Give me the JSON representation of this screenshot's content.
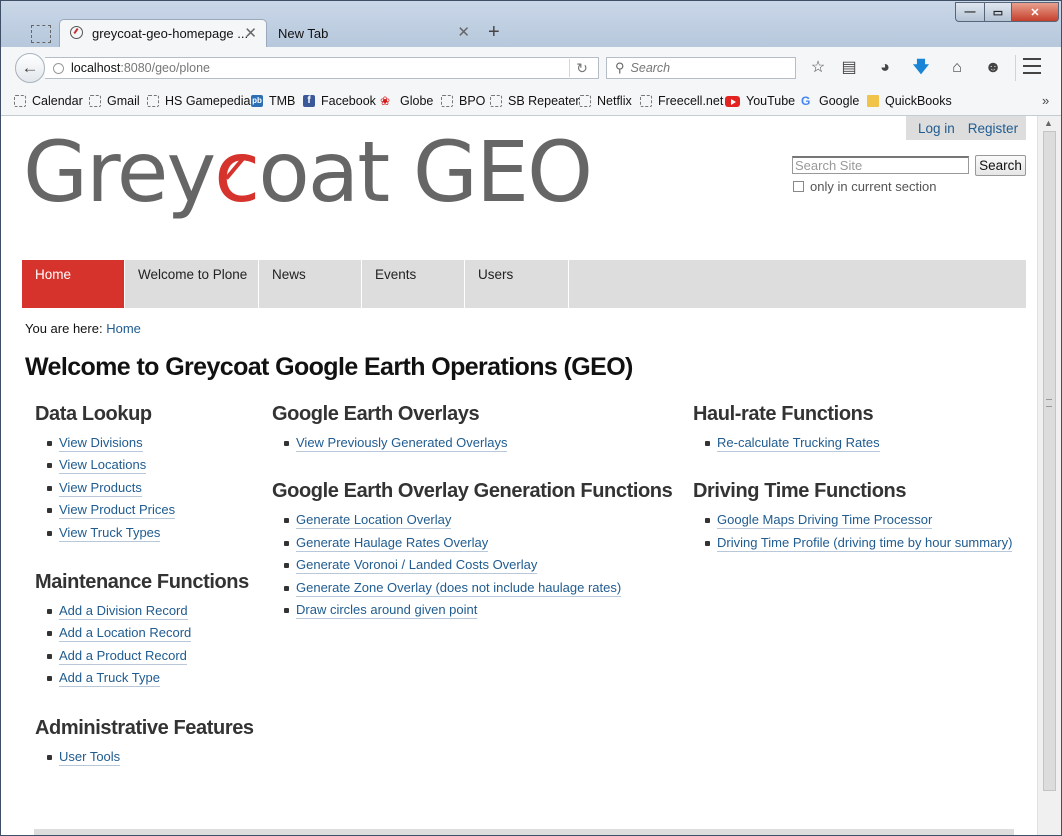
{
  "browser": {
    "tabs": [
      {
        "title": "greycoat-geo-homepage ...",
        "active": true
      },
      {
        "title": "New Tab",
        "active": false
      }
    ],
    "url_host": "localhost",
    "url_path": ":8080/geo/plone",
    "search_placeholder": "Search",
    "window_controls": {
      "minimize": "—",
      "maximize": "▭",
      "close": "✕"
    },
    "bookmarks": [
      {
        "label": "Calendar",
        "icon": "page"
      },
      {
        "label": "Gmail",
        "icon": "page"
      },
      {
        "label": "HS Gamepedia",
        "icon": "page"
      },
      {
        "label": "TMB",
        "icon": "pb"
      },
      {
        "label": "Facebook",
        "icon": "fb"
      },
      {
        "label": "Globe",
        "icon": "leaf"
      },
      {
        "label": "BPO",
        "icon": "page"
      },
      {
        "label": "SB Repeater",
        "icon": "page"
      },
      {
        "label": "Netflix",
        "icon": "page"
      },
      {
        "label": "Freecell.net",
        "icon": "page"
      },
      {
        "label": "YouTube",
        "icon": "yt"
      },
      {
        "label": "Google",
        "icon": "g"
      },
      {
        "label": "QuickBooks",
        "icon": "folder"
      }
    ]
  },
  "site": {
    "logo_left": "Grey",
    "logo_red": "c",
    "logo_right": "oat GEO",
    "login": "Log in",
    "register": "Register",
    "search_placeholder": "Search Site",
    "search_button": "Search",
    "section_only": "only in current section",
    "nav": [
      "Home",
      "Welcome to Plone",
      "News",
      "Events",
      "Users"
    ],
    "breadcrumb_prefix": "You are here:",
    "breadcrumb_home": "Home",
    "page_title": "Welcome to Greycoat Google Earth Operations (GEO)",
    "columns": [
      {
        "groups": [
          {
            "heading": "Data Lookup",
            "links": [
              "View Divisions",
              "View Locations",
              "View Products",
              "View Product Prices",
              "View Truck Types"
            ]
          },
          {
            "heading": "Maintenance Functions",
            "links": [
              "Add a Division Record",
              "Add a Location Record",
              "Add a Product Record",
              "Add a Truck Type"
            ]
          },
          {
            "heading": "Administrative Features",
            "links": [
              "User Tools"
            ]
          }
        ]
      },
      {
        "groups": [
          {
            "heading": "Google Earth Overlays",
            "links": [
              "View Previously Generated Overlays"
            ]
          },
          {
            "heading": "Google Earth Overlay Generation Functions",
            "links": [
              "Generate Location Overlay",
              "Generate Haulage Rates Overlay",
              "Generate Voronoi / Landed Costs Overlay",
              "Generate Zone Overlay (does not include haulage rates)",
              "Draw circles around given point"
            ]
          }
        ]
      },
      {
        "groups": [
          {
            "heading": "Haul-rate Functions",
            "links": [
              "Re-calculate Trucking Rates"
            ]
          },
          {
            "heading": "Driving Time Functions",
            "links": [
              "Google Maps Driving Time Processor",
              "Driving Time Profile (driving time by hour summary)"
            ]
          }
        ]
      }
    ]
  }
}
